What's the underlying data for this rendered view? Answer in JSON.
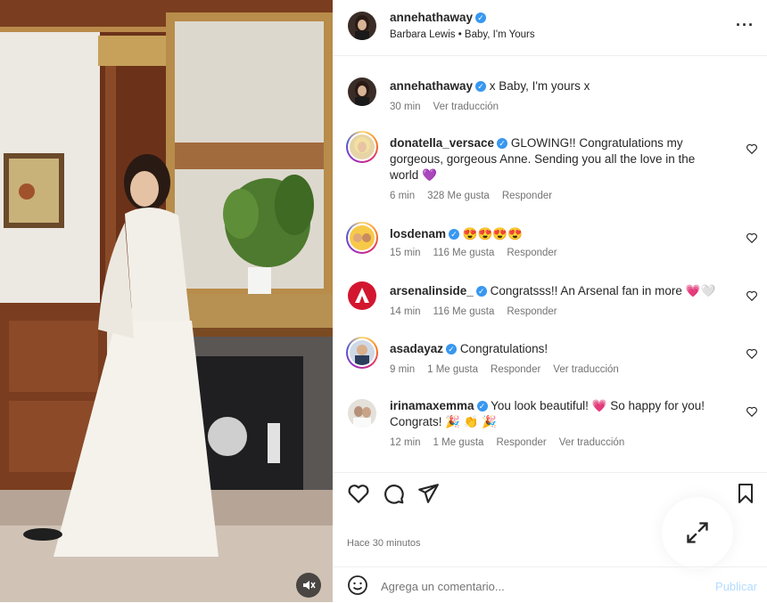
{
  "header": {
    "username": "annehathaway",
    "audio": "Barbara Lewis • Baby, I'm Yours",
    "more_icon": "more-horizontal-icon"
  },
  "caption": {
    "username": "annehathaway",
    "text": "x Baby, I'm yours x",
    "time": "30 min",
    "translate": "Ver traducción"
  },
  "comments": [
    {
      "username": "donatella_versace",
      "text": "GLOWING!! Congratulations my gorgeous, gorgeous Anne. Sending you all the love in the world 💜",
      "time": "6 min",
      "likes": "328 Me gusta",
      "reply": "Responder",
      "translate": ""
    },
    {
      "username": "losdenam",
      "text": "😍😍😍😍",
      "time": "15 min",
      "likes": "116 Me gusta",
      "reply": "Responder",
      "translate": ""
    },
    {
      "username": "arsenalinside_",
      "text": "Congratsss!! An Arsenal fan in more 💗🤍",
      "time": "14 min",
      "likes": "116 Me gusta",
      "reply": "Responder",
      "translate": ""
    },
    {
      "username": "asadayaz",
      "text": "Congratulations!",
      "time": "9 min",
      "likes": "1 Me gusta",
      "reply": "Responder",
      "translate": "Ver traducción"
    },
    {
      "username": "irinamaxemma",
      "text": "You look beautiful! 💗 So happy for you! Congrats! 🎉 👏 🎉",
      "time": "12 min",
      "likes": "1 Me gusta",
      "reply": "Responder",
      "translate": "Ver traducción"
    }
  ],
  "post": {
    "timestamp": "Hace 30 minutos"
  },
  "add_comment": {
    "placeholder": "Agrega un comentario...",
    "publish": "Publicar"
  },
  "colors": {
    "verified": "#3897f0",
    "publish": "#b3dbff",
    "muted": "#737373"
  }
}
